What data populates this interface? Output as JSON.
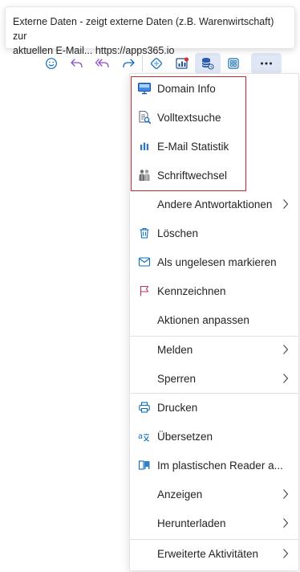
{
  "tooltip": {
    "line1": "Externe Daten - zeigt externe Daten (z.B. Warenwirtschaft) zur",
    "line2": "aktuellen E-Mail... https://apps365.io"
  },
  "toolbar": {
    "buttons": [
      "smiley-icon",
      "reply-icon",
      "reply-all-icon",
      "forward-icon",
      "addin-icon",
      "chart-icon",
      "external-data-icon",
      "apps-icon",
      "more-icon"
    ]
  },
  "menu": {
    "addin_items": [
      {
        "label": "Domain Info",
        "icon": "monitor-icon"
      },
      {
        "label": "Volltextsuche",
        "icon": "document-search-icon"
      },
      {
        "label": "E-Mail Statistik",
        "icon": "bar-chart-icon"
      },
      {
        "label": "Schriftwechsel",
        "icon": "people-icon"
      }
    ],
    "group1": [
      {
        "label": "Andere Antwortaktionen",
        "has_submenu": true
      },
      {
        "label": "Löschen",
        "icon": "trash-icon"
      },
      {
        "label": "Als ungelesen markieren",
        "icon": "envelope-icon"
      },
      {
        "label": "Kennzeichnen",
        "icon": "flag-icon"
      },
      {
        "label": "Aktionen anpassen"
      }
    ],
    "group2": [
      {
        "label": "Melden",
        "has_submenu": true
      },
      {
        "label": "Sperren",
        "has_submenu": true
      }
    ],
    "group3": [
      {
        "label": "Drucken",
        "icon": "printer-icon"
      },
      {
        "label": "Übersetzen",
        "icon": "translate-icon"
      },
      {
        "label": "Im plastischen Reader a...",
        "icon": "immersive-reader-icon"
      },
      {
        "label": "Anzeigen",
        "has_submenu": true
      },
      {
        "label": "Herunterladen",
        "has_submenu": true
      }
    ],
    "group4": [
      {
        "label": "Erweiterte Aktivitäten",
        "has_submenu": true
      }
    ]
  },
  "colors": {
    "accent": "#0f6cbd",
    "addin_purple": "#8a4fc5",
    "highlight_border": "#c4262e",
    "flag": "#b53a6a"
  }
}
